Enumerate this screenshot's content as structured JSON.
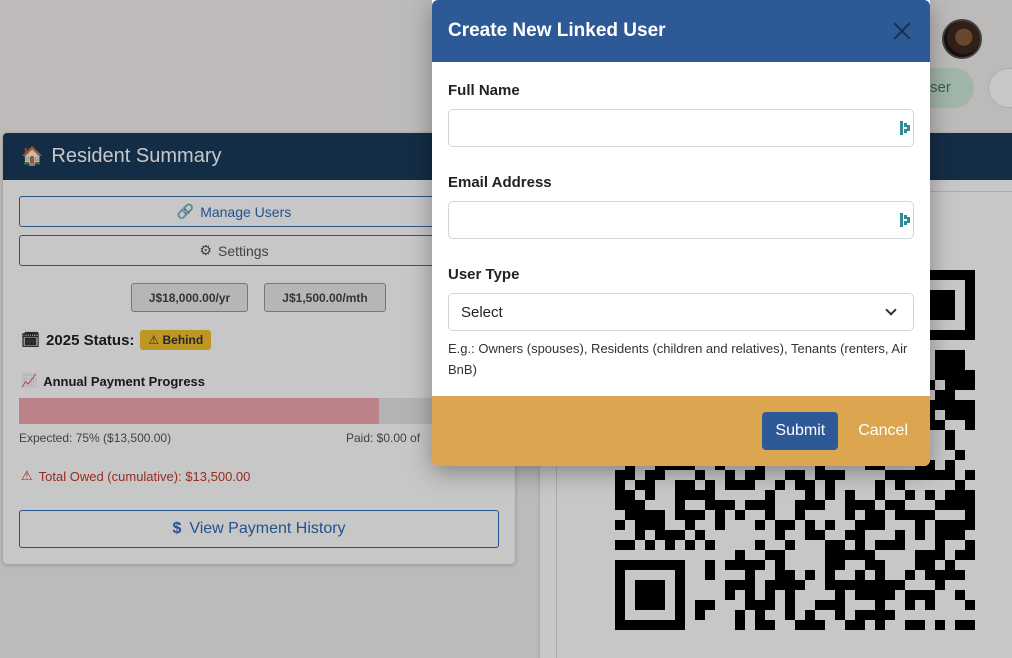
{
  "header": {
    "pill_label": "ser"
  },
  "summary": {
    "title": "Resident Summary",
    "manage_users": "Manage Users",
    "settings": "Settings",
    "annual_fee": "J$18,000.00/yr",
    "monthly_fee": "J$1,500.00/mth",
    "status_label": "2025 Status:",
    "status_badge": "Behind",
    "progress_label": "Annual Payment Progress",
    "progress_fraction": 0.75,
    "expected_text": "Expected: 75% ($13,500.00)",
    "paid_text": "Paid: $0.00 of",
    "owed_text": "Total Owed (cumulative): $13,500.00",
    "history_button": "View Payment History"
  },
  "modal": {
    "title": "Create New Linked User",
    "full_name_label": "Full Name",
    "full_name_value": "",
    "email_label": "Email Address",
    "email_value": "",
    "user_type_label": "User Type",
    "user_type_selected": "Select",
    "hint": "E.g.: Owners (spouses), Residents (children and relatives), Tenants (renters, Air BnB)",
    "submit": "Submit",
    "cancel": "Cancel"
  },
  "colors": {
    "modal_header": "#2d5a97",
    "modal_footer": "#dca54f",
    "card_header": "#1a3a5a",
    "badge": "#f2c12e",
    "owed": "#c0392b"
  }
}
